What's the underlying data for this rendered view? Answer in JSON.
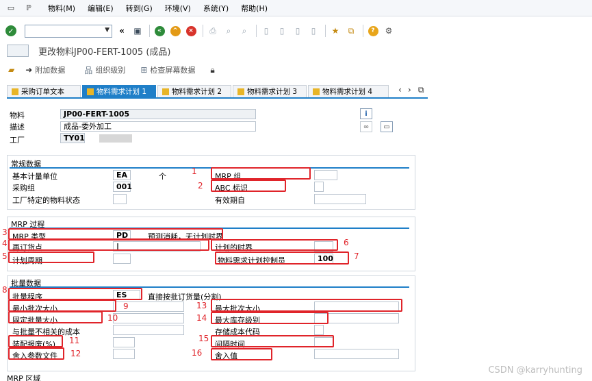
{
  "menu": [
    "物料(M)",
    "编辑(E)",
    "转到(G)",
    "环境(V)",
    "系统(Y)",
    "帮助(H)"
  ],
  "title": "更改物料JP00-FERT-1005 (成品)",
  "app_toolbar": [
    "附加数据",
    "组织级别",
    "检查屏幕数据"
  ],
  "tabs": [
    "采购订单文本",
    "物料需求计划 1",
    "物料需求计划 2",
    "物料需求计划 3",
    "物料需求计划 4"
  ],
  "header": {
    "material_label": "物料",
    "material_value": "JP00-FERT-1005",
    "desc_label": "描述",
    "desc_value": "成品-委外加工",
    "plant_label": "工厂",
    "plant_value": "TY01"
  },
  "general": {
    "title": "常规数据",
    "base_uom_label": "基本计量单位",
    "base_uom_value": "EA",
    "base_uom_text": "个",
    "purch_group_label": "采购组",
    "purch_group_value": "001",
    "plant_status_label": "工厂特定的物料状态",
    "mrp_group_label": "MRP 组",
    "abc_label": "ABC 标识",
    "valid_from_label": "有效期自"
  },
  "mrp": {
    "title": "MRP 过程",
    "mrp_type_label": "MRP 类型",
    "mrp_type_value": "PD",
    "mrp_type_text": "预测消耗，无计划时界",
    "reorder_label": "再订货点",
    "reorder_value": "|",
    "plan_cycle_label": "计划周期",
    "time_fence_label": "计划的时界",
    "controller_label": "物料需求计划控制员",
    "controller_value": "100"
  },
  "lot": {
    "title": "批量数据",
    "procedure_label": "批量程序",
    "procedure_value": "ES",
    "procedure_text": "直接按批订货量(分割)",
    "min_lot_label": "最小批次大小",
    "fixed_lot_label": "固定批量大小",
    "lot_indep_label": "与批量不相关的成本",
    "assembly_scrap_label": "装配报废(%)",
    "rounding_profile_label": "舍入参数文件",
    "max_lot_label": "最大批次大小",
    "max_stock_label": "最大库存级别",
    "storage_cost_label": "存储成本代码",
    "takt_label": "间隔时间",
    "rounding_value_label": "舍入值"
  },
  "next_section": "MRP 区域",
  "markers": [
    "1",
    "2",
    "3",
    "4",
    "5",
    "6",
    "7",
    "8",
    "9",
    "10",
    "11",
    "12",
    "13",
    "14",
    "15",
    "16"
  ],
  "watermark": "CSDN @karryhunting",
  "colors": {
    "accent": "#1f7fc8",
    "highlight": "#e0242a",
    "ok": "#2e8b3a"
  }
}
